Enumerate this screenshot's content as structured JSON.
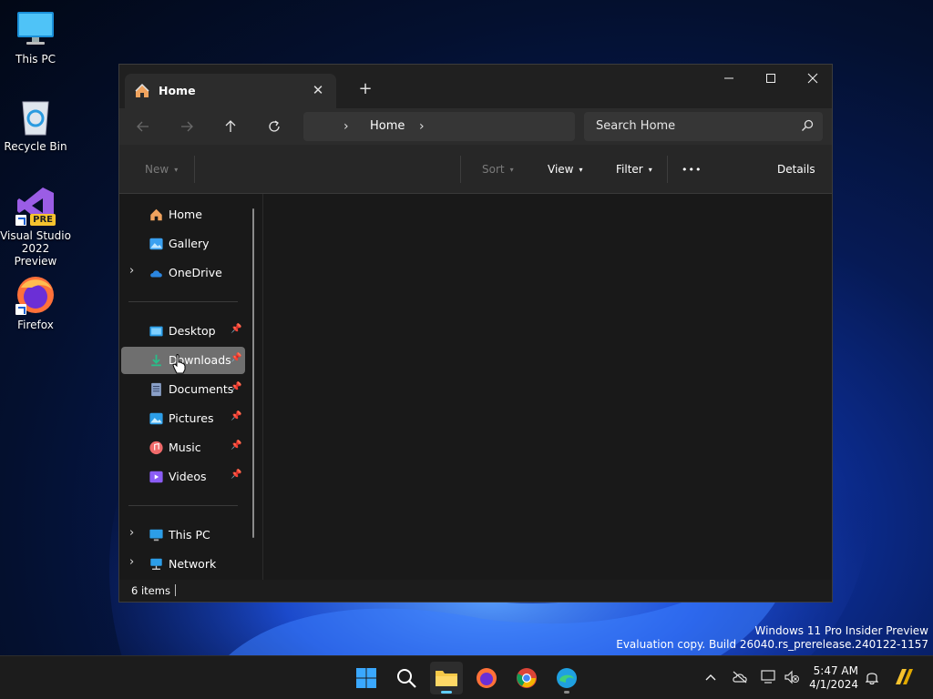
{
  "desktop": {
    "icons": [
      {
        "label": "This PC"
      },
      {
        "label": "Recycle Bin"
      },
      {
        "label": "Visual Studio 2022 Preview",
        "badge": "PRE"
      },
      {
        "label": "Firefox"
      }
    ],
    "watermark": {
      "line1": "Windows 11 Pro Insider Preview",
      "line2": "Evaluation copy. Build 26040.rs_prerelease.240122-1157"
    }
  },
  "explorer": {
    "tab_title": "Home",
    "address_crumb": "Home",
    "search_placeholder": "Search Home",
    "toolbar": {
      "new_label": "New",
      "sort_label": "Sort",
      "view_label": "View",
      "filter_label": "Filter",
      "more_label": "•••",
      "details_label": "Details"
    },
    "nav": {
      "home": "Home",
      "gallery": "Gallery",
      "onedrive": "OneDrive",
      "desktop": "Desktop",
      "downloads": "Downloads",
      "documents": "Documents",
      "pictures": "Pictures",
      "music": "Music",
      "videos": "Videos",
      "this_pc": "This PC",
      "network": "Network"
    },
    "status": "6 items"
  },
  "taskbar": {
    "time": "5:47 AM",
    "date": "4/1/2024"
  },
  "colors": {
    "accent": "#60cdff",
    "window_bg": "#191919",
    "selection": "#6f6f6f"
  }
}
